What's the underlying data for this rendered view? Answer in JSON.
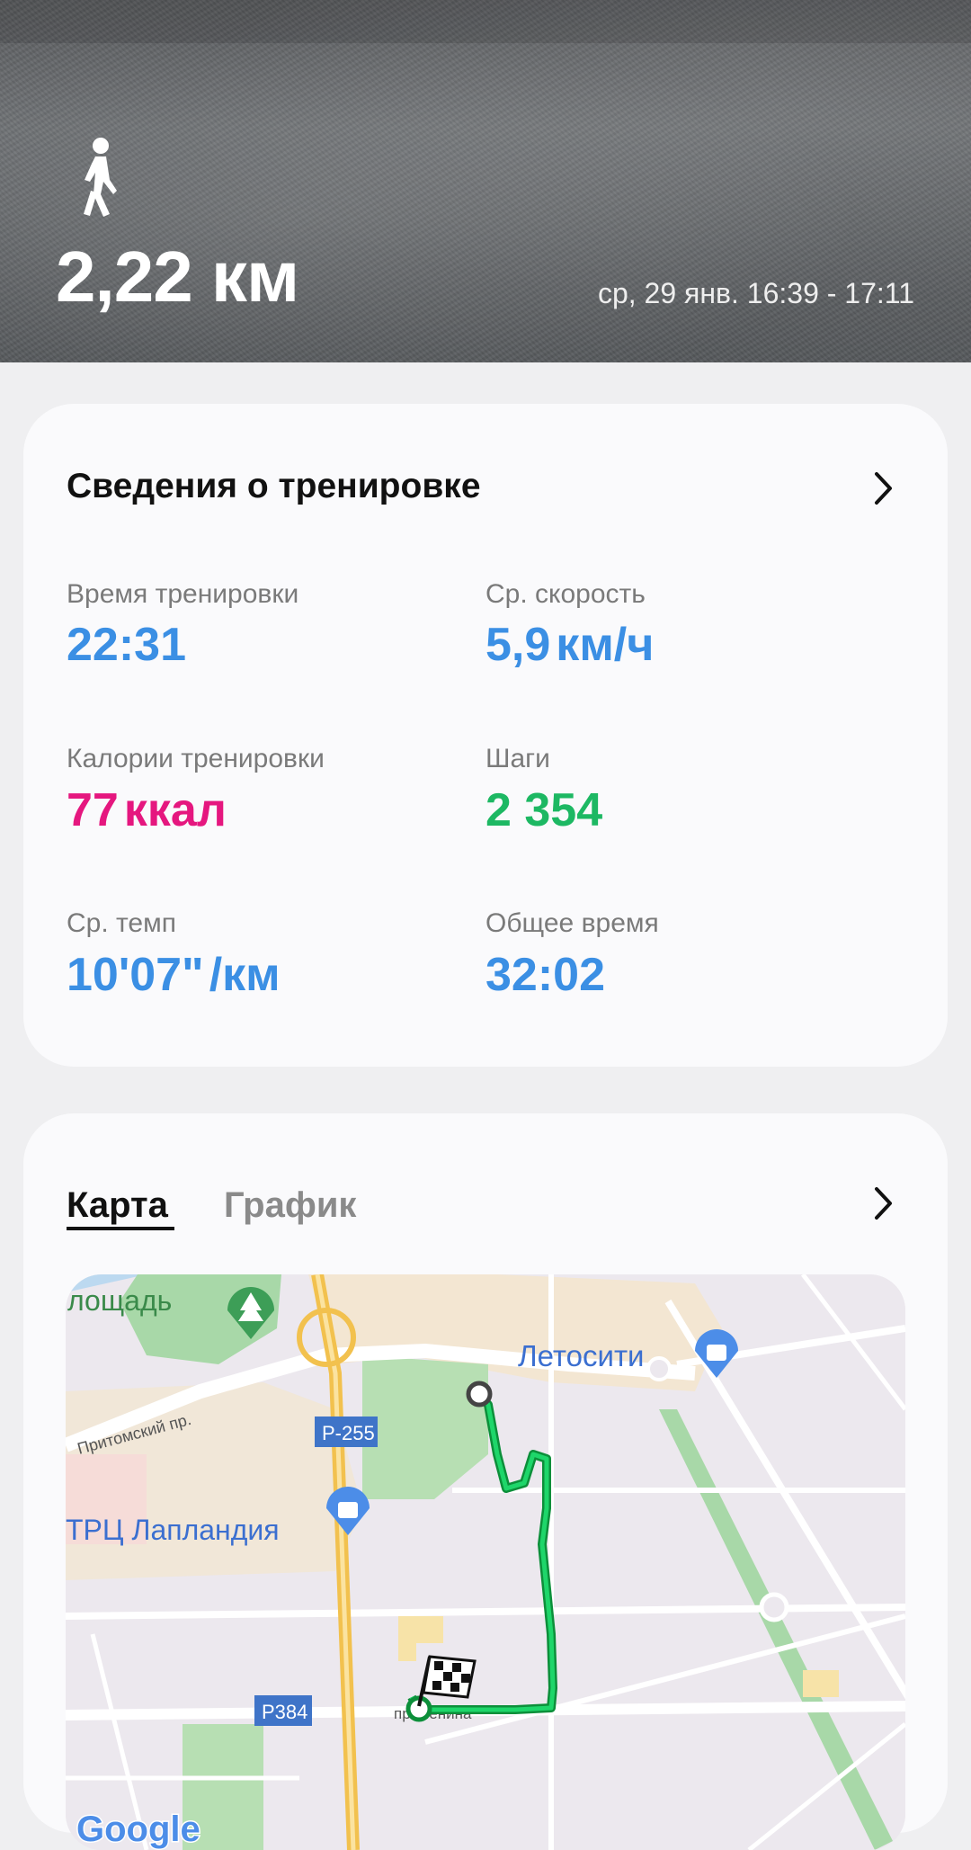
{
  "hero": {
    "activity_icon": "walking-person-icon",
    "distance": "2,22 км",
    "datetime": "ср, 29 янв. 16:39 - 17:11"
  },
  "workout": {
    "title": "Сведения о тренировке",
    "stats": [
      {
        "label": "Время тренировки",
        "value": "22:31",
        "unit": "",
        "color": "#3b8fe4"
      },
      {
        "label": "Ср. скорость",
        "value": "5,9",
        "unit": "км/ч",
        "color": "#3b8fe4"
      },
      {
        "label": "Калории тренировки",
        "value": "77",
        "unit": "ккал",
        "color": "#e5177f"
      },
      {
        "label": "Шаги",
        "value": "2 354",
        "unit": "",
        "color": "#1db863"
      },
      {
        "label": "Ср. темп",
        "value": "10'07\"",
        "unit": "/км",
        "color": "#3b8fe4"
      },
      {
        "label": "Общее время",
        "value": "32:02",
        "unit": "",
        "color": "#3b8fe4"
      }
    ]
  },
  "map_card": {
    "tabs": [
      "Карта",
      "График"
    ],
    "active_tab": "Карта",
    "map_labels": {
      "square": "лощадь",
      "letocity": "Летосити",
      "pritomsky": "Притомский пр.",
      "r255": "Р-255",
      "laplandia": "ТРЦ Лапландия",
      "r384": "Р384",
      "lenina": "пр. Ленина",
      "google": "Google"
    }
  }
}
